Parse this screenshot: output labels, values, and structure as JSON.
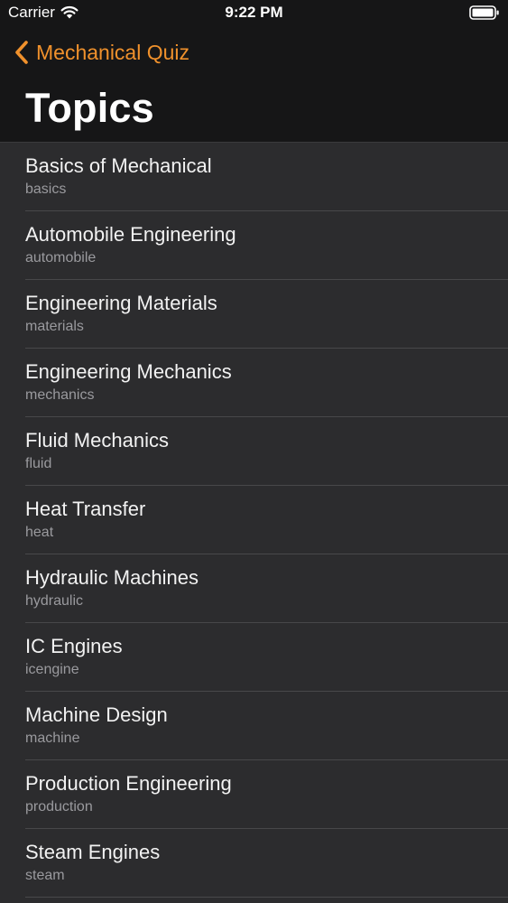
{
  "status_bar": {
    "carrier": "Carrier",
    "time": "9:22 PM"
  },
  "nav": {
    "back_label": "Mechanical Quiz",
    "title": "Topics",
    "accent_color": "#f0912c"
  },
  "topics": [
    {
      "title": "Basics of Mechanical",
      "subtitle": "basics"
    },
    {
      "title": "Automobile Engineering",
      "subtitle": "automobile"
    },
    {
      "title": "Engineering Materials",
      "subtitle": "materials"
    },
    {
      "title": "Engineering Mechanics",
      "subtitle": "mechanics"
    },
    {
      "title": "Fluid Mechanics",
      "subtitle": "fluid"
    },
    {
      "title": "Heat Transfer",
      "subtitle": "heat"
    },
    {
      "title": "Hydraulic Machines",
      "subtitle": "hydraulic"
    },
    {
      "title": "IC Engines",
      "subtitle": "icengine"
    },
    {
      "title": "Machine Design",
      "subtitle": "machine"
    },
    {
      "title": "Production Engineering",
      "subtitle": "production"
    },
    {
      "title": "Steam Engines",
      "subtitle": "steam"
    }
  ]
}
